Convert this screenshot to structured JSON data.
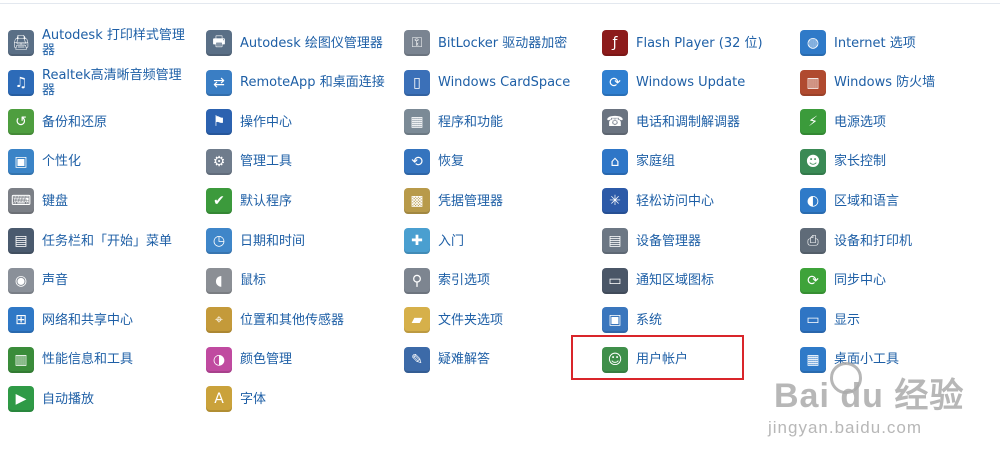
{
  "control_panel": {
    "items": [
      {
        "label": "Autodesk 打印样式管理器",
        "icon": "printer-style-icon",
        "color": "#5a6f86",
        "glyph": "🖨"
      },
      {
        "label": "Realtek高清晰音频管理器",
        "icon": "audio-manager-icon",
        "color": "#2d6bb8",
        "glyph": "♫"
      },
      {
        "label": "备份和还原",
        "icon": "backup-restore-icon",
        "color": "#4e9e3f",
        "glyph": "↺"
      },
      {
        "label": "个性化",
        "icon": "personalization-icon",
        "color": "#3b84c7",
        "glyph": "▣"
      },
      {
        "label": "键盘",
        "icon": "keyboard-icon",
        "color": "#7b7f86",
        "glyph": "⌨"
      },
      {
        "label": "任务栏和「开始」菜单",
        "icon": "taskbar-icon",
        "color": "#4a5a6e",
        "glyph": "▤"
      },
      {
        "label": "声音",
        "icon": "speaker-icon",
        "color": "#8a9099",
        "glyph": "◉"
      },
      {
        "label": "网络和共享中心",
        "icon": "network-icon",
        "color": "#2f78c6",
        "glyph": "⊞"
      },
      {
        "label": "性能信息和工具",
        "icon": "performance-icon",
        "color": "#3a8c3a",
        "glyph": "▥"
      },
      {
        "label": "自动播放",
        "icon": "autoplay-icon",
        "color": "#2f9a46",
        "glyph": "▶"
      },
      {
        "label": "Autodesk 绘图仪管理器",
        "icon": "plotter-manager-icon",
        "color": "#5a6f86",
        "glyph": "🖶"
      },
      {
        "label": "RemoteApp 和桌面连接",
        "icon": "remoteapp-icon",
        "color": "#3a7ec4",
        "glyph": "⇄"
      },
      {
        "label": "操作中心",
        "icon": "action-center-flag-icon",
        "color": "#2c62b0",
        "glyph": "⚑"
      },
      {
        "label": "管理工具",
        "icon": "admin-tools-icon",
        "color": "#6f7c8c",
        "glyph": "⚙"
      },
      {
        "label": "默认程序",
        "icon": "default-programs-icon",
        "color": "#3c9a3c",
        "glyph": "✔"
      },
      {
        "label": "日期和时间",
        "icon": "calendar-clock-icon",
        "color": "#3f86c9",
        "glyph": "◷"
      },
      {
        "label": "鼠标",
        "icon": "mouse-icon",
        "color": "#8b8f95",
        "glyph": "◖"
      },
      {
        "label": "位置和其他传感器",
        "icon": "location-sensor-icon",
        "color": "#c49a3a",
        "glyph": "⌖"
      },
      {
        "label": "颜色管理",
        "icon": "color-management-icon",
        "color": "#c04aa0",
        "glyph": "◑"
      },
      {
        "label": "字体",
        "icon": "font-icon",
        "color": "#caa23b",
        "glyph": "A"
      },
      {
        "label": "BitLocker 驱动器加密",
        "icon": "bitlocker-key-icon",
        "color": "#7a8491",
        "glyph": "⚿"
      },
      {
        "label": "Windows CardSpace",
        "icon": "cardspace-icon",
        "color": "#3b70b8",
        "glyph": "▯"
      },
      {
        "label": "程序和功能",
        "icon": "programs-features-icon",
        "color": "#7b8a96",
        "glyph": "▦"
      },
      {
        "label": "恢复",
        "icon": "recovery-icon",
        "color": "#3574be",
        "glyph": "⟲"
      },
      {
        "label": "凭据管理器",
        "icon": "credential-manager-icon",
        "color": "#b89a4a",
        "glyph": "▩"
      },
      {
        "label": "入门",
        "icon": "getting-started-icon",
        "color": "#4a9fd0",
        "glyph": "✚"
      },
      {
        "label": "索引选项",
        "icon": "indexing-search-icon",
        "color": "#7d8590",
        "glyph": "⚲"
      },
      {
        "label": "文件夹选项",
        "icon": "folder-options-icon",
        "color": "#d6b04a",
        "glyph": "▰"
      },
      {
        "label": "疑难解答",
        "icon": "troubleshooting-icon",
        "color": "#3c6aa8",
        "glyph": "✎"
      },
      {
        "label": "Flash Player (32 位)",
        "icon": "flash-player-icon",
        "color": "#8c1b1b",
        "glyph": "ƒ"
      },
      {
        "label": "Windows Update",
        "icon": "windows-update-icon",
        "color": "#2f7fd0",
        "glyph": "⟳"
      },
      {
        "label": "电话和调制解调器",
        "icon": "phone-modem-icon",
        "color": "#6a7380",
        "glyph": "☎"
      },
      {
        "label": "家庭组",
        "icon": "homegroup-icon",
        "color": "#2e76c7",
        "glyph": "⌂"
      },
      {
        "label": "轻松访问中心",
        "icon": "ease-of-access-icon",
        "color": "#2c5aa8",
        "glyph": "✳"
      },
      {
        "label": "设备管理器",
        "icon": "device-manager-icon",
        "color": "#6c7784",
        "glyph": "▤"
      },
      {
        "label": "通知区域图标",
        "icon": "notification-area-icon",
        "color": "#4a5667",
        "glyph": "▭"
      },
      {
        "label": "系统",
        "icon": "system-icon",
        "color": "#3a76bd",
        "glyph": "▣"
      },
      {
        "label": "用户帐户",
        "icon": "user-accounts-icon",
        "color": "#3f8f4a",
        "glyph": "☺"
      },
      {
        "label": "Internet 选项",
        "icon": "internet-options-icon",
        "color": "#2f7ac8",
        "glyph": "◍"
      },
      {
        "label": "Windows 防火墙",
        "icon": "firewall-icon",
        "color": "#b04a2f",
        "glyph": "▥"
      },
      {
        "label": "电源选项",
        "icon": "power-options-icon",
        "color": "#3b9b3b",
        "glyph": "⚡"
      },
      {
        "label": "家长控制",
        "icon": "parental-controls-icon",
        "color": "#3a8a55",
        "glyph": "☻"
      },
      {
        "label": "区域和语言",
        "icon": "region-language-icon",
        "color": "#2f7ac8",
        "glyph": "◐"
      },
      {
        "label": "设备和打印机",
        "icon": "devices-printers-icon",
        "color": "#5f6b78",
        "glyph": "⎙"
      },
      {
        "label": "同步中心",
        "icon": "sync-center-icon",
        "color": "#3ea33a",
        "glyph": "⟳"
      },
      {
        "label": "显示",
        "icon": "display-icon",
        "color": "#2f75c4",
        "glyph": "▭"
      },
      {
        "label": "桌面小工具",
        "icon": "desktop-gadgets-icon",
        "color": "#2f7ac8",
        "glyph": "▦"
      }
    ]
  },
  "watermark": {
    "brand": "Bai du 经验",
    "url": "jingyan.baidu.com"
  },
  "colors": {
    "link_text": "#1e5fa6",
    "highlight_border": "#d9252a"
  }
}
